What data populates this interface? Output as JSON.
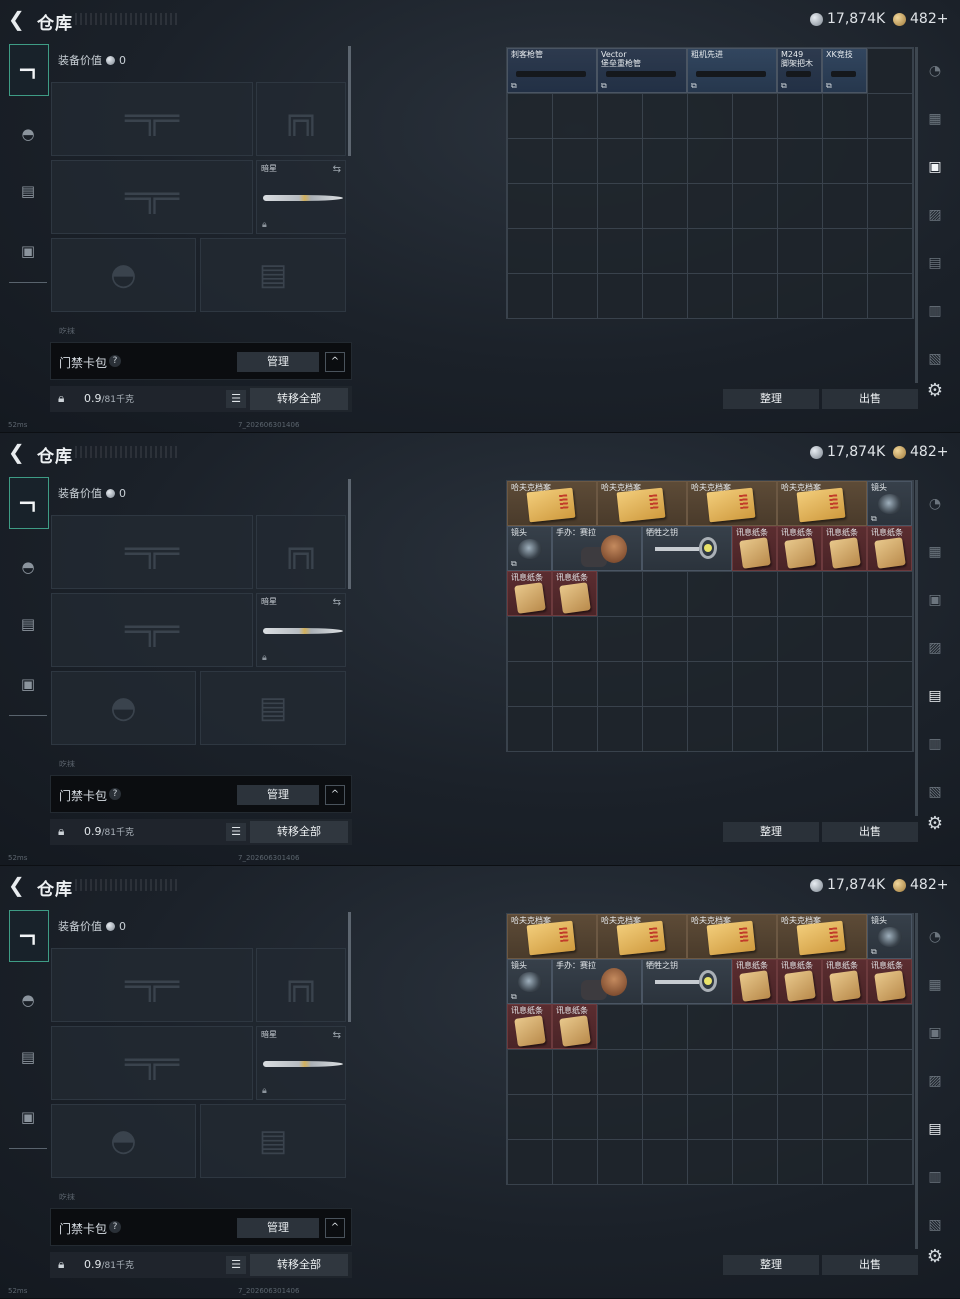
{
  "header": {
    "title": "仓库",
    "silver": "17,874K",
    "gold": "482+"
  },
  "equipment": {
    "value_label": "装备价值",
    "value": "0",
    "melee_name": "暗星",
    "faded_label": "吃抹"
  },
  "card_pack": {
    "label": "门禁卡包",
    "help": "?",
    "manage": "管理",
    "expand": "^"
  },
  "capacity": {
    "current": "0.9",
    "max": "/81千克",
    "transfer_all": "转移全部"
  },
  "status": {
    "ping": "52ms",
    "build": "7_202606301406"
  },
  "actions": {
    "sort": "整理",
    "sell": "出售"
  },
  "panels": [
    {
      "items": [
        {
          "label": "刺客枪管",
          "kind": "weapon",
          "col": 0,
          "row": 0,
          "w": 2
        },
        {
          "label": "Vector\n堡垒重枪管",
          "kind": "weapon",
          "col": 2,
          "row": 0,
          "w": 2
        },
        {
          "label": "粗机先进",
          "kind": "weapon blue",
          "col": 4,
          "row": 0,
          "w": 2
        },
        {
          "label": "M249\n脚架把木",
          "kind": "weapon",
          "col": 6,
          "row": 0,
          "w": 1
        },
        {
          "label": "XK竞技",
          "kind": "weapon blue",
          "col": 7,
          "row": 0,
          "w": 1
        }
      ],
      "active_rail": 3
    },
    {
      "items": [
        {
          "label": "哈夫克档案",
          "kind": "orange folder",
          "col": 0,
          "row": 0,
          "w": 2
        },
        {
          "label": "哈夫克档案",
          "kind": "orange folder",
          "col": 2,
          "row": 0,
          "w": 2
        },
        {
          "label": "哈夫克档案",
          "kind": "orange folder",
          "col": 4,
          "row": 0,
          "w": 2
        },
        {
          "label": "哈夫克档案",
          "kind": "orange folder",
          "col": 6,
          "row": 0,
          "w": 2
        },
        {
          "label": "镜头",
          "kind": "plain scope",
          "col": 8,
          "row": 0,
          "w": 1
        },
        {
          "label": "镜头",
          "kind": "plain scope",
          "col": 0,
          "row": 1,
          "w": 1
        },
        {
          "label": "手办：赛拉",
          "kind": "plain figure",
          "col": 1,
          "row": 1,
          "w": 2
        },
        {
          "label": "牺牲之钥",
          "kind": "plain key",
          "col": 3,
          "row": 1,
          "w": 2
        },
        {
          "label": "讯息纸条",
          "kind": "red paper",
          "col": 5,
          "row": 1,
          "w": 1
        },
        {
          "label": "讯息纸条",
          "kind": "red paper",
          "col": 6,
          "row": 1,
          "w": 1
        },
        {
          "label": "讯息纸条",
          "kind": "red paper",
          "col": 7,
          "row": 1,
          "w": 1
        },
        {
          "label": "讯息纸条",
          "kind": "red paper",
          "col": 8,
          "row": 1,
          "w": 1
        },
        {
          "label": "讯息纸条",
          "kind": "red paper",
          "col": 0,
          "row": 2,
          "w": 1
        },
        {
          "label": "讯息纸条",
          "kind": "red paper",
          "col": 1,
          "row": 2,
          "w": 1
        }
      ],
      "active_rail": 5
    },
    {
      "items": [
        {
          "label": "哈夫克档案",
          "kind": "orange folder",
          "col": 0,
          "row": 0,
          "w": 2
        },
        {
          "label": "哈夫克档案",
          "kind": "orange folder",
          "col": 2,
          "row": 0,
          "w": 2
        },
        {
          "label": "哈夫克档案",
          "kind": "orange folder",
          "col": 4,
          "row": 0,
          "w": 2
        },
        {
          "label": "哈夫克档案",
          "kind": "orange folder",
          "col": 6,
          "row": 0,
          "w": 2
        },
        {
          "label": "镜头",
          "kind": "plain scope",
          "col": 8,
          "row": 0,
          "w": 1
        },
        {
          "label": "镜头",
          "kind": "plain scope",
          "col": 0,
          "row": 1,
          "w": 1
        },
        {
          "label": "手办：赛拉",
          "kind": "plain figure",
          "col": 1,
          "row": 1,
          "w": 2
        },
        {
          "label": "牺牲之钥",
          "kind": "plain key",
          "col": 3,
          "row": 1,
          "w": 2
        },
        {
          "label": "讯息纸条",
          "kind": "red paper",
          "col": 5,
          "row": 1,
          "w": 1
        },
        {
          "label": "讯息纸条",
          "kind": "red paper",
          "col": 6,
          "row": 1,
          "w": 1
        },
        {
          "label": "讯息纸条",
          "kind": "red paper",
          "col": 7,
          "row": 1,
          "w": 1
        },
        {
          "label": "讯息纸条",
          "kind": "red paper",
          "col": 8,
          "row": 1,
          "w": 1
        },
        {
          "label": "讯息纸条",
          "kind": "red paper",
          "col": 0,
          "row": 2,
          "w": 1
        },
        {
          "label": "讯息纸条",
          "kind": "red paper",
          "col": 1,
          "row": 2,
          "w": 1
        }
      ],
      "active_rail": 5
    }
  ],
  "icons": {
    "back": "back-arrow-icon",
    "silver": "silver-coin-icon",
    "gold": "gold-coin-icon",
    "settings": "gear-icon",
    "lock": "lock-icon",
    "list": "list-icon",
    "swap": "swap-icon"
  },
  "colors": {
    "accent": "#3e9c85",
    "orange_rarity": "#5d4b37",
    "red_rarity": "#5b2d30",
    "blue_rarity": "#32465f"
  }
}
